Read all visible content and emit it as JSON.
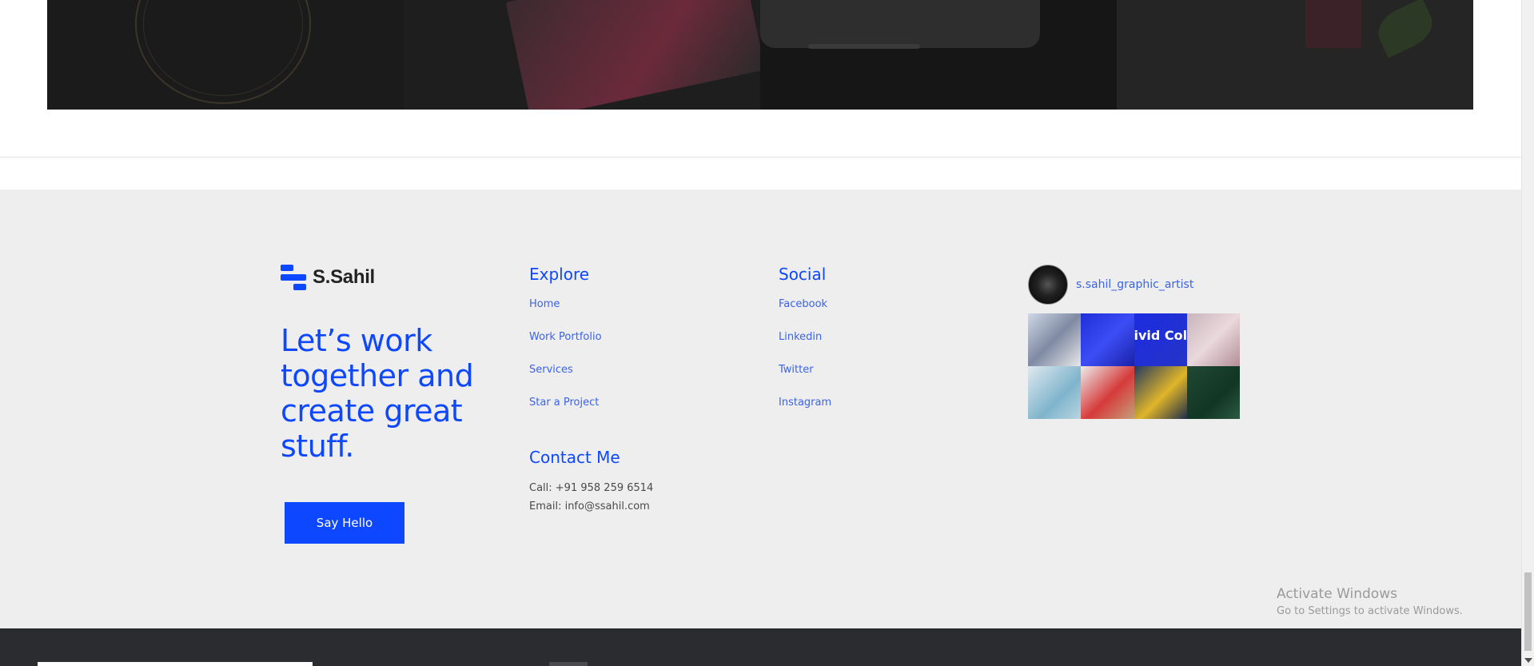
{
  "brand": {
    "name": "S.Sahil"
  },
  "tagline": "Let’s work together and create great stuff.",
  "cta": {
    "label": "Say Hello"
  },
  "explore": {
    "heading": "Explore",
    "items": [
      "Home",
      "Work Portfolio",
      "Services",
      "Star a Project"
    ]
  },
  "social": {
    "heading": "Social",
    "items": [
      "Facebook",
      "Linkedin",
      "Twitter",
      "Instagram"
    ]
  },
  "contact": {
    "heading": "Contact Me",
    "call": "Call: +91 958 259 6514",
    "email": "Email: info@ssahil.com"
  },
  "instagram": {
    "handle": "s.sahil_graphic_artist",
    "tile_text": "ivid Col"
  },
  "windows_notice": {
    "title": "Activate Windows",
    "subtitle": "Go to Settings to activate Windows."
  },
  "colors": {
    "accent": "#0d47ff",
    "footer_bg": "#eeeeee",
    "bottom_bar": "#2a2c30"
  }
}
